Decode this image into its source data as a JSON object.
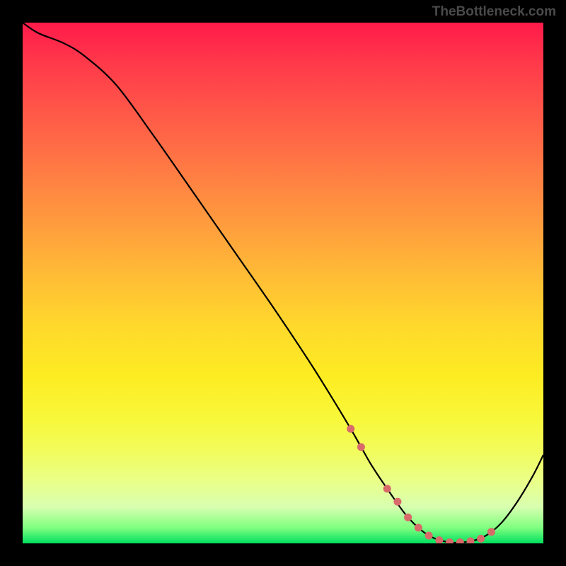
{
  "watermark": "TheBottleneck.com",
  "chart_data": {
    "type": "line",
    "title": "",
    "xlabel": "",
    "ylabel": "",
    "xlim": [
      0,
      100
    ],
    "ylim": [
      0,
      100
    ],
    "series": [
      {
        "name": "curve",
        "x": [
          0,
          3,
          8,
          12,
          18,
          25,
          32,
          40,
          48,
          55,
          60,
          63,
          65,
          67,
          70,
          74,
          78,
          82,
          86,
          89,
          92,
          95,
          98,
          100
        ],
        "values": [
          100,
          98,
          96,
          93.5,
          88,
          78.5,
          68.5,
          57,
          45.5,
          35,
          27,
          22,
          18.5,
          15,
          10.5,
          5,
          1.5,
          0.2,
          0.4,
          1.5,
          4,
          8,
          13,
          17
        ]
      }
    ],
    "annotations": {
      "marker_color": "#d96a6a",
      "markers_x": [
        63,
        65,
        70,
        72,
        74,
        76,
        78,
        80,
        82,
        84,
        86,
        88,
        90
      ],
      "markers_y": [
        22,
        18.5,
        10.5,
        8,
        5,
        3,
        1.5,
        0.6,
        0.2,
        0.2,
        0.4,
        0.9,
        2.2
      ]
    },
    "background": {
      "type": "vertical-gradient",
      "stops": [
        {
          "pos": 0,
          "color": "#ff1a4a"
        },
        {
          "pos": 50,
          "color": "#ffd82c"
        },
        {
          "pos": 85,
          "color": "#f2fc5a"
        },
        {
          "pos": 100,
          "color": "#00e060"
        }
      ]
    }
  }
}
